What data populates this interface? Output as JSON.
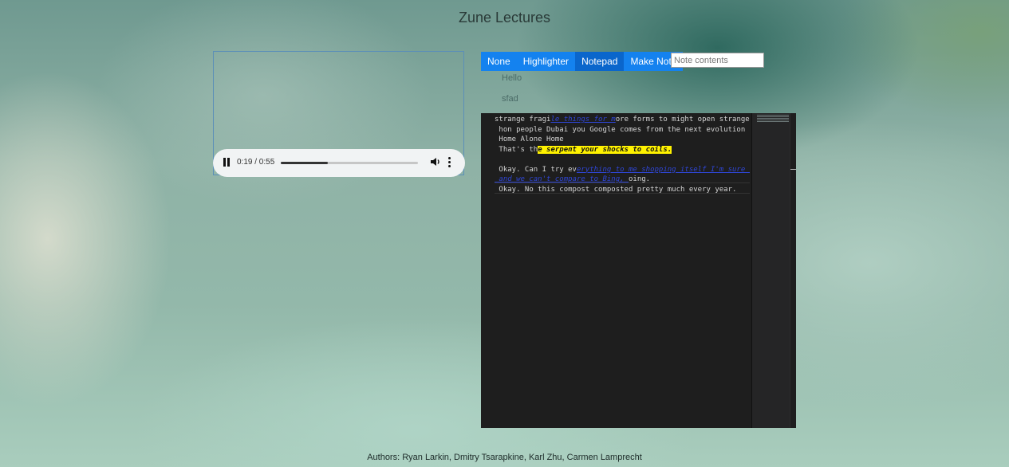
{
  "page": {
    "title": "Zune Lectures"
  },
  "audio_player": {
    "time_display": "0:19 / 0:55",
    "progress_fraction": 0.345,
    "play_state": "playing",
    "icons": [
      "pause-icon",
      "volume-icon",
      "more-vert-icon"
    ]
  },
  "toolbar": {
    "buttons": [
      {
        "label": "None",
        "active": false
      },
      {
        "label": "Highlighter",
        "active": false
      },
      {
        "label": "Notepad",
        "active": true
      },
      {
        "label": "Make Note",
        "active": false
      }
    ],
    "note_input_placeholder": "Note contents",
    "note_input_value": ""
  },
  "notes": [
    "Hello",
    "sfad"
  ],
  "editor": {
    "lines": [
      {
        "parts": [
          {
            "t": "strange fragi",
            "s": "plain"
          },
          {
            "t": "le things for m",
            "s": "link"
          },
          {
            "t": "ore forms to might open stranger th",
            "s": "plain"
          }
        ]
      },
      {
        "parts": [
          {
            "t": " hon people Dubai you Google comes from the next evolution of th",
            "s": "plain"
          }
        ]
      },
      {
        "parts": [
          {
            "t": " Home Alone Home",
            "s": "plain"
          }
        ]
      },
      {
        "parts": [
          {
            "t": " That's th",
            "s": "plain"
          },
          {
            "t": "e serpent your shocks to coils.",
            "s": "yellow"
          }
        ]
      },
      {
        "parts": [
          {
            "t": "",
            "s": "plain"
          }
        ]
      },
      {
        "parts": [
          {
            "t": " Okay. Can I try ev",
            "s": "plain"
          },
          {
            "t": "erything to me shopping itself I'm sure that",
            "s": "link"
          }
        ]
      },
      {
        "parts": [
          {
            "t": " and we can't compare to Bing, ",
            "s": "link"
          },
          {
            "t": "oing.",
            "s": "plain"
          }
        ]
      },
      {
        "parts": [
          {
            "t": " Okay. No this compost composted pretty much every year.",
            "s": "plain"
          }
        ]
      }
    ],
    "colors": {
      "background": "#1e1e1e",
      "highlight": "#fff200",
      "link": "#2f46d6"
    }
  },
  "footer": {
    "authors": "Authors: Ryan Larkin, Dmitry Tsarapkine, Karl Zhu, Carmen Lamprecht"
  },
  "colors": {
    "button": "#1482ef",
    "button_active": "#0a66cc"
  }
}
